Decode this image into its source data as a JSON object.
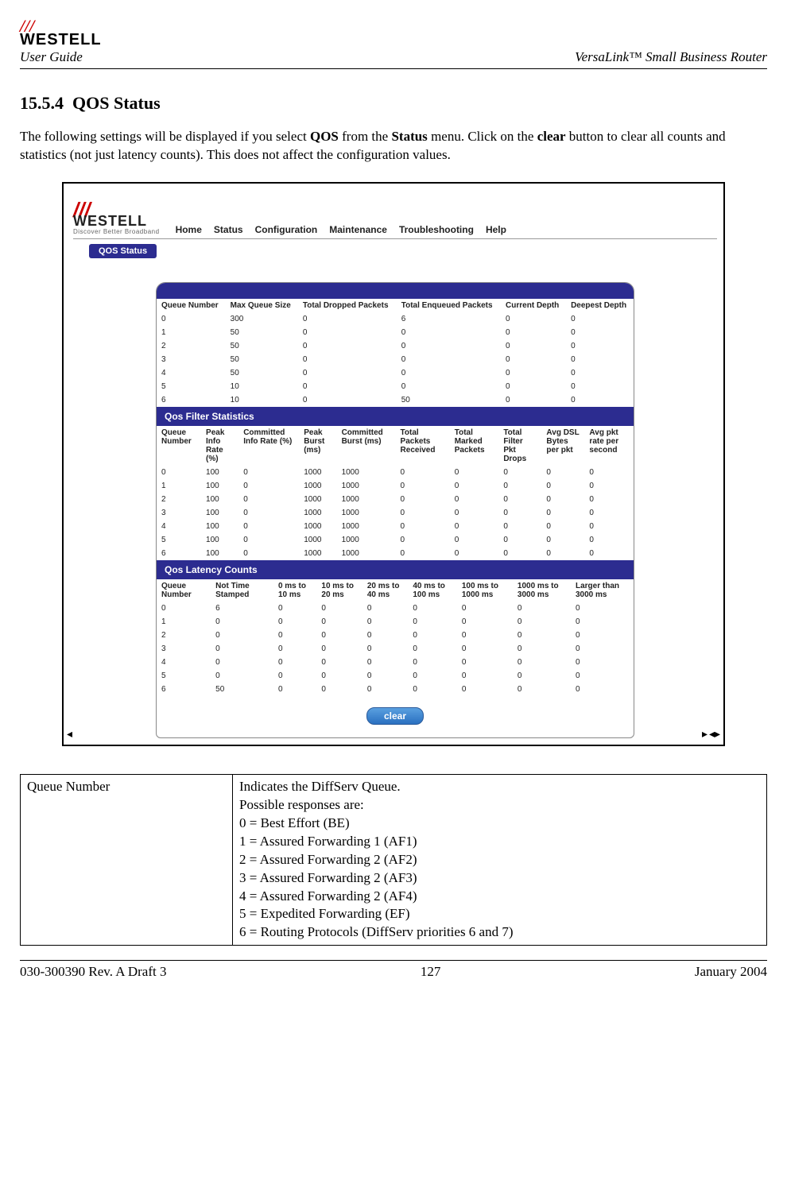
{
  "header": {
    "brand": "WESTELL",
    "user_guide": "User Guide",
    "product_name": "VersaLink™  Small Business Router"
  },
  "section": {
    "number": "15.5.4",
    "title": "QOS Status"
  },
  "intro": {
    "pre": "The following settings will be displayed if you select ",
    "b1": "QOS",
    "mid1": " from the ",
    "b2": "Status",
    "mid2": " menu. Click on the ",
    "b3": "clear",
    "post": " button to clear all counts and statistics (not just latency counts). This does not affect the configuration values."
  },
  "ui": {
    "logo": "WESTELL",
    "tagline": "Discover Better Broadband",
    "menu": [
      "Home",
      "Status",
      "Configuration",
      "Maintenance",
      "Troubleshooting",
      "Help"
    ],
    "tab": "QOS Status",
    "panel_top_head": "",
    "table1_headers": [
      "Queue Number",
      "Max Queue Size",
      "Total Dropped Packets",
      "Total Enqueued Packets",
      "Current Depth",
      "Deepest Depth"
    ],
    "table1_rows": [
      [
        "0",
        "300",
        "0",
        "6",
        "0",
        "0"
      ],
      [
        "1",
        "50",
        "0",
        "0",
        "0",
        "0"
      ],
      [
        "2",
        "50",
        "0",
        "0",
        "0",
        "0"
      ],
      [
        "3",
        "50",
        "0",
        "0",
        "0",
        "0"
      ],
      [
        "4",
        "50",
        "0",
        "0",
        "0",
        "0"
      ],
      [
        "5",
        "10",
        "0",
        "0",
        "0",
        "0"
      ],
      [
        "6",
        "10",
        "0",
        "50",
        "0",
        "0"
      ]
    ],
    "bar2": "Qos Filter Statistics",
    "table2_headers": [
      "Queue Number",
      "Peak Info Rate (%)",
      "Committed Info Rate (%)",
      "Peak Burst (ms)",
      "Committed Burst (ms)",
      "Total Packets Received",
      "Total Marked Packets",
      "Total Filter Pkt Drops",
      "Avg DSL Bytes per pkt",
      "Avg pkt rate per second"
    ],
    "table2_rows": [
      [
        "0",
        "100",
        "0",
        "1000",
        "1000",
        "0",
        "0",
        "0",
        "0",
        "0"
      ],
      [
        "1",
        "100",
        "0",
        "1000",
        "1000",
        "0",
        "0",
        "0",
        "0",
        "0"
      ],
      [
        "2",
        "100",
        "0",
        "1000",
        "1000",
        "0",
        "0",
        "0",
        "0",
        "0"
      ],
      [
        "3",
        "100",
        "0",
        "1000",
        "1000",
        "0",
        "0",
        "0",
        "0",
        "0"
      ],
      [
        "4",
        "100",
        "0",
        "1000",
        "1000",
        "0",
        "0",
        "0",
        "0",
        "0"
      ],
      [
        "5",
        "100",
        "0",
        "1000",
        "1000",
        "0",
        "0",
        "0",
        "0",
        "0"
      ],
      [
        "6",
        "100",
        "0",
        "1000",
        "1000",
        "0",
        "0",
        "0",
        "0",
        "0"
      ]
    ],
    "bar3": "Qos Latency Counts",
    "table3_headers": [
      "Queue Number",
      "Not Time Stamped",
      "0 ms to 10 ms",
      "10 ms to 20 ms",
      "20 ms to 40 ms",
      "40 ms to 100 ms",
      "100 ms to 1000 ms",
      "1000 ms to 3000 ms",
      "Larger than 3000 ms"
    ],
    "table3_rows": [
      [
        "0",
        "6",
        "0",
        "0",
        "0",
        "0",
        "0",
        "0",
        "0"
      ],
      [
        "1",
        "0",
        "0",
        "0",
        "0",
        "0",
        "0",
        "0",
        "0"
      ],
      [
        "2",
        "0",
        "0",
        "0",
        "0",
        "0",
        "0",
        "0",
        "0"
      ],
      [
        "3",
        "0",
        "0",
        "0",
        "0",
        "0",
        "0",
        "0",
        "0"
      ],
      [
        "4",
        "0",
        "0",
        "0",
        "0",
        "0",
        "0",
        "0",
        "0"
      ],
      [
        "5",
        "0",
        "0",
        "0",
        "0",
        "0",
        "0",
        "0",
        "0"
      ],
      [
        "6",
        "50",
        "0",
        "0",
        "0",
        "0",
        "0",
        "0",
        "0"
      ]
    ],
    "clear_btn": "clear"
  },
  "desc_table": {
    "left": "Queue Number",
    "right_lines": [
      "Indicates the DiffServ Queue.",
      "Possible responses are:",
      "0 = Best Effort (BE)",
      "1 = Assured Forwarding 1 (AF1)",
      "2 = Assured Forwarding 2 (AF2)",
      "3 = Assured Forwarding 2 (AF3)",
      "4 = Assured Forwarding 2 (AF4)",
      "5 = Expedited Forwarding (EF)",
      "6 = Routing Protocols (DiffServ priorities 6 and 7)"
    ]
  },
  "footer": {
    "left": "030-300390 Rev. A Draft 3",
    "center": "127",
    "right": "January 2004"
  }
}
